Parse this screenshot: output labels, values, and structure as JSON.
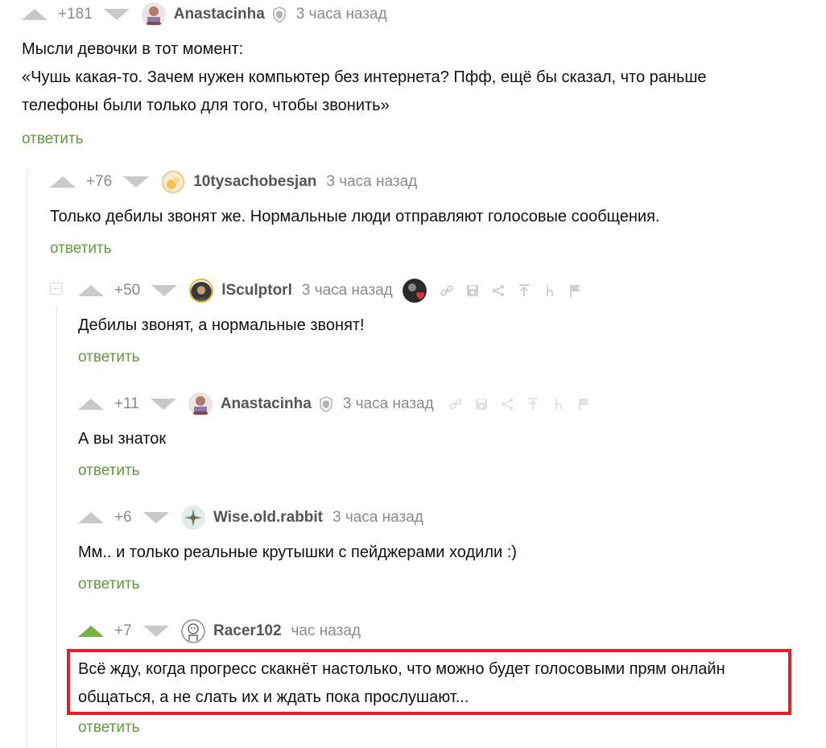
{
  "comments": [
    {
      "score": "+181",
      "user": "Anastacinha",
      "time": "3 часа назад",
      "lines": [
        "Мысли девочки в тот момент:",
        "«Чушь какая-то. Зачем нужен компьютер без интернета? Пфф, ещё бы сказал, что раньше",
        "телефоны были только для того, чтобы звонить»"
      ],
      "reply": "ответить"
    },
    {
      "score": "+76",
      "user": "10tysachobesjan",
      "time": "3 часа назад",
      "lines": [
        "Только дебилы звонят же. Нормальные люди отправляют голосовые сообщения."
      ],
      "reply": "ответить"
    },
    {
      "score": "+50",
      "user": "lSculptorl",
      "time": "3 часа назад",
      "lines": [
        "Дебилы звонят, а нормальные звонят!"
      ],
      "reply": "ответить"
    },
    {
      "score": "+11",
      "user": "Anastacinha",
      "time": "3 часа назад",
      "lines": [
        "А вы знаток"
      ],
      "reply": "ответить"
    },
    {
      "score": "+6",
      "user": "Wise.old.rabbit",
      "time": "3 часа назад",
      "lines": [
        "Мм.. и только реальные крутышки с пейджерами ходили :)"
      ],
      "reply": "ответить"
    },
    {
      "score": "+7",
      "user": "Racer102",
      "time": "час назад",
      "lines": [
        "Всё жду, когда прогресс скакнёт настолько, что можно будет голосовыми прям онлайн",
        "общаться, а не слать их и ждать пока прослушают..."
      ],
      "reply": "ответить"
    }
  ],
  "icons": {
    "vote_up": "arrow-up-icon",
    "vote_down": "arrow-down-icon",
    "verified": "shield-icon",
    "tools": [
      "link-icon",
      "save-icon",
      "share-icon",
      "pin-top-icon",
      "tree-icon",
      "report-flag-icon"
    ]
  },
  "colors": {
    "vote_active": "#77b43f",
    "reply_link": "#5f9b3a",
    "highlight_frame": "#e0202a"
  }
}
